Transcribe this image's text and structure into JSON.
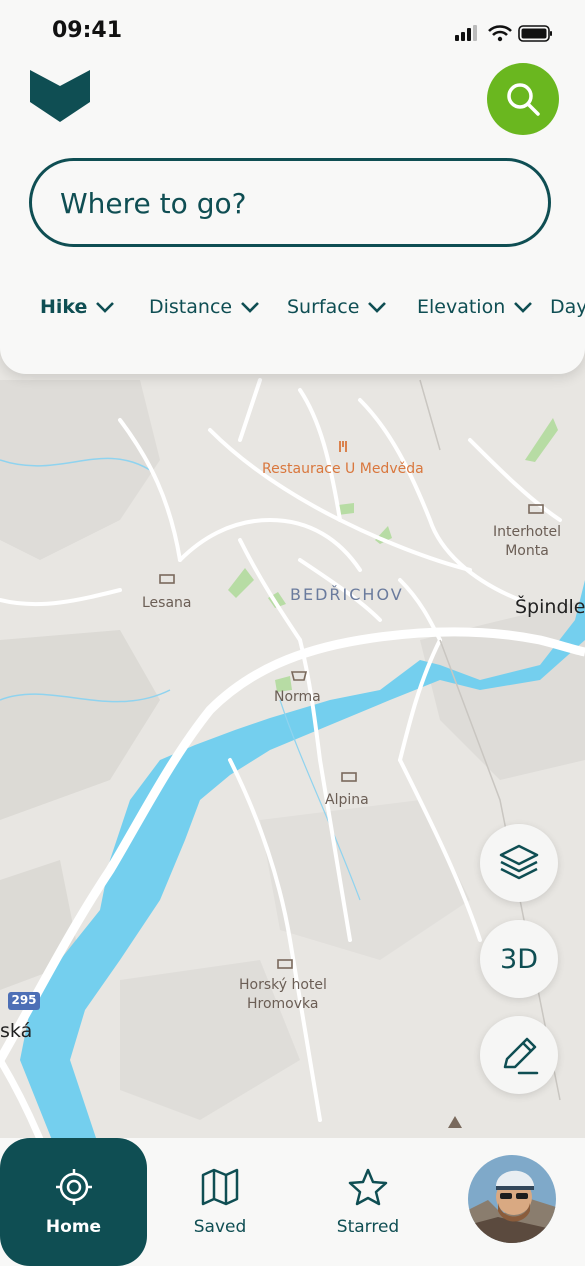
{
  "status_bar": {
    "time": "09:41"
  },
  "header": {
    "search": {
      "placeholder": "Where to go?"
    },
    "filters": [
      {
        "label": "Hike"
      },
      {
        "label": "Distance"
      },
      {
        "label": "Surface"
      },
      {
        "label": "Elevation"
      },
      {
        "label": "Day"
      }
    ]
  },
  "map": {
    "labels": {
      "restaurant": "Restaurace U Medvěda",
      "hotel_right": "Interhotel Monta",
      "lesana": "Lesana",
      "village": "BEDŘICHOV",
      "town": "Špindle",
      "norma": "Norma",
      "alpina": "Alpina",
      "horsky_1": "Horský hotel",
      "horsky_2": "Hromovka",
      "road_number": "295",
      "left_edge": "ská"
    }
  },
  "controls": {
    "three_d_label": "3D"
  },
  "bottom_nav": {
    "home": "Home",
    "saved": "Saved",
    "starred": "Starred"
  },
  "colors": {
    "primary": "#0f4e53",
    "accent": "#6ab71f",
    "water": "#74cfee"
  }
}
